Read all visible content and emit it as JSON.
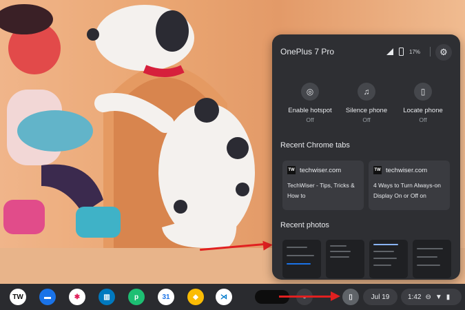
{
  "phone_hub": {
    "device_name": "OnePlus 7 Pro",
    "battery": "17%",
    "quick_actions": [
      {
        "label": "Enable hotspot",
        "state": "Off",
        "icon": "hotspot-icon"
      },
      {
        "label": "Silence phone",
        "state": "Off",
        "icon": "bell-icon"
      },
      {
        "label": "Locate phone",
        "state": "Off",
        "icon": "phone-locate-icon"
      }
    ],
    "recent_tabs_title": "Recent Chrome tabs",
    "recent_tabs": [
      {
        "site": "techwiser.com",
        "title": "TechWiser - Tips, Tricks & How to"
      },
      {
        "site": "techwiser.com",
        "title": "4 Ways to Turn Always-on Display On or Off on"
      }
    ],
    "recent_photos_title": "Recent photos"
  },
  "shelf": {
    "apps": [
      {
        "name": "TechWiser",
        "icon": "techwiser-icon",
        "glyph": "TW",
        "bg": "#ffffff",
        "fg": "#111111"
      },
      {
        "name": "Files",
        "icon": "files-icon",
        "glyph": "▬",
        "bg": "#1a73e8",
        "fg": "#ffffff"
      },
      {
        "name": "Slack",
        "icon": "slack-icon",
        "glyph": "✱",
        "bg": "#ffffff",
        "fg": "#e01e5a"
      },
      {
        "name": "Trello",
        "icon": "trello-icon",
        "glyph": "▥",
        "bg": "#0079bf",
        "fg": "#ffffff"
      },
      {
        "name": "PicsArt",
        "icon": "picsart-icon",
        "glyph": "p",
        "bg": "#1dbf73",
        "fg": "#ffffff"
      },
      {
        "name": "Calendar",
        "icon": "calendar-icon",
        "glyph": "31",
        "bg": "#ffffff",
        "fg": "#1a73e8"
      },
      {
        "name": "Keep",
        "icon": "keep-icon",
        "glyph": "◆",
        "bg": "#fbbc04",
        "fg": "#ffffff"
      },
      {
        "name": "VS Code",
        "icon": "vscode-icon",
        "glyph": "⋊",
        "bg": "#ffffff",
        "fg": "#007acc"
      }
    ],
    "date": "Jul 19",
    "time": "1:42"
  },
  "colors": {
    "annotation_arrow": "#e02020",
    "panel_bg": "#2e2f33"
  }
}
